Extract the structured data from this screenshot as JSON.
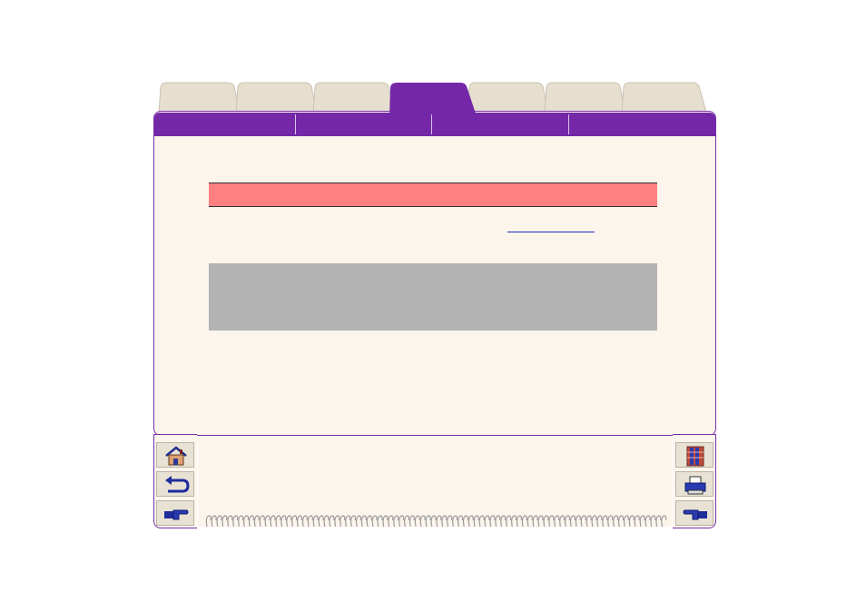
{
  "tabs": [
    {
      "label": "",
      "active": false
    },
    {
      "label": "",
      "active": false
    },
    {
      "label": "",
      "active": false
    },
    {
      "label": "",
      "active": true
    },
    {
      "label": "",
      "active": false
    },
    {
      "label": "",
      "active": false
    },
    {
      "label": "",
      "active": false
    }
  ],
  "subnav": [
    "",
    "",
    "",
    ""
  ],
  "content": {
    "heading": "",
    "link_text": "",
    "note": ""
  },
  "nav_buttons": {
    "left": [
      "home-icon",
      "back-arrow-icon",
      "next-hand-icon"
    ],
    "right": [
      "index-book-icon",
      "print-icon",
      "prev-hand-icon"
    ]
  },
  "colors": {
    "accent_purple": "#7428a8",
    "tab_inactive": "#e6dfcf",
    "page_bg": "#fcf5ec",
    "heading_band": "#ff8080",
    "note_band": "#b3b3b3",
    "link": "#1b2fc4"
  }
}
